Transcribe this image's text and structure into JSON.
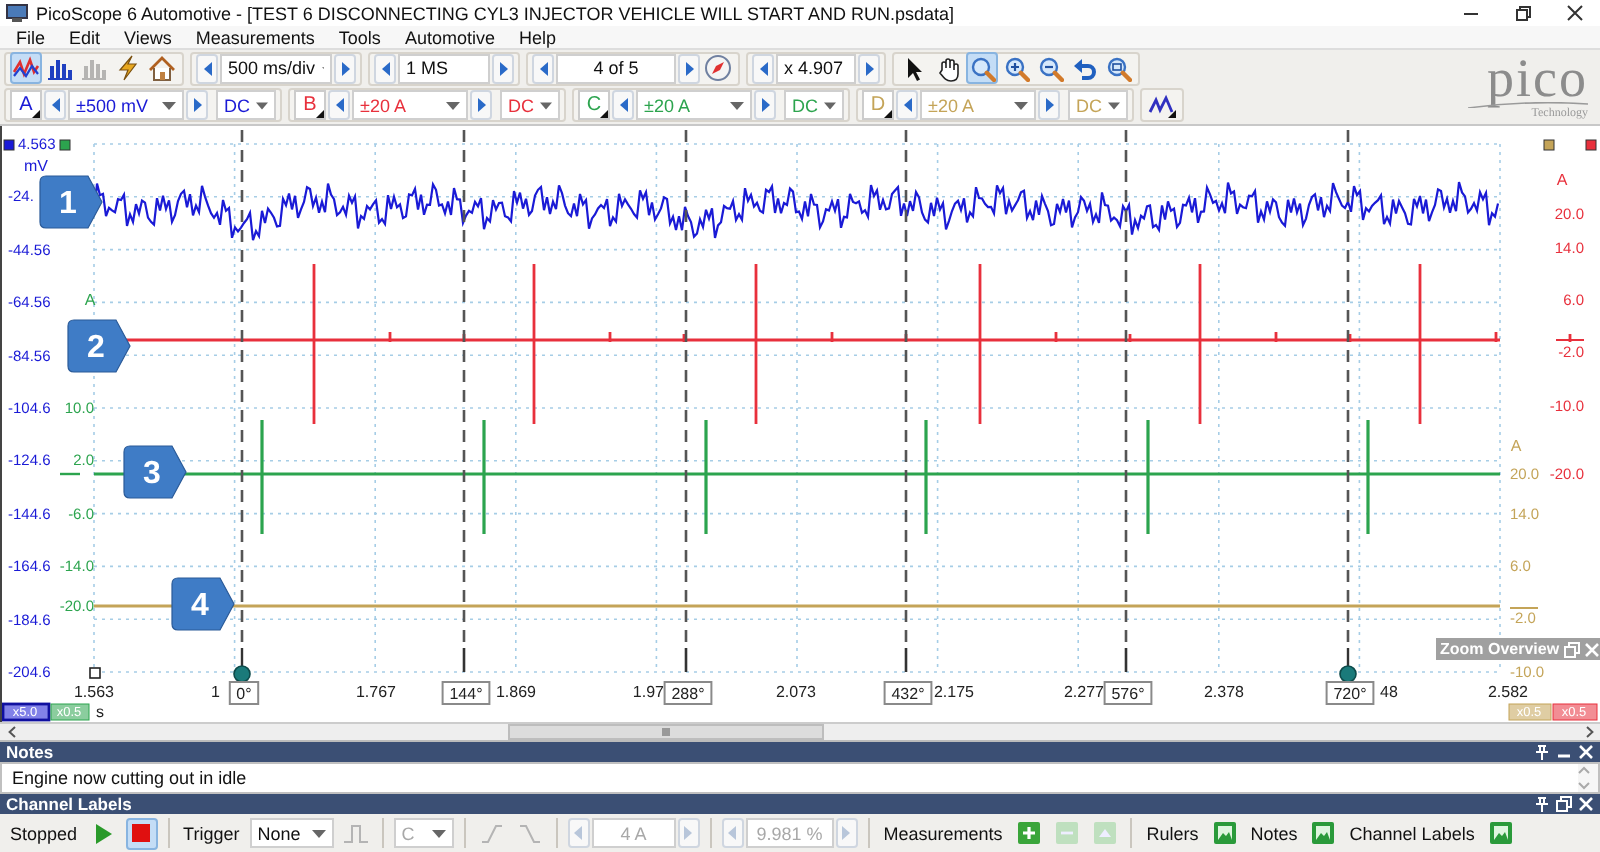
{
  "window": {
    "title": "PicoScope 6 Automotive - [TEST 6 DISCONNECTING CYL3 INJECTOR VEHICLE WILL START AND RUN.psdata]"
  },
  "menu": [
    "File",
    "Edit",
    "Views",
    "Measurements",
    "Tools",
    "Automotive",
    "Help"
  ],
  "toolbar": {
    "modes": [
      {
        "kind": "scope",
        "selected": true,
        "disabled": false
      },
      {
        "kind": "spectrum",
        "selected": false,
        "disabled": false
      },
      {
        "kind": "persistence",
        "selected": false,
        "disabled": true
      }
    ],
    "actions": [
      {
        "kind": "wizard"
      },
      {
        "kind": "home"
      }
    ],
    "timebase": "500 ms/div",
    "samples": "1 MS",
    "buffer": "4 of 5",
    "zoom_factor": "x 4.907",
    "tools": [
      {
        "kind": "pointer",
        "selected": false
      },
      {
        "kind": "hand",
        "selected": false
      },
      {
        "kind": "zoom",
        "selected": true
      },
      {
        "kind": "zoom-in",
        "selected": false
      },
      {
        "kind": "zoom-out",
        "selected": false
      },
      {
        "kind": "undo",
        "selected": false
      },
      {
        "kind": "zoom-fit",
        "selected": false
      }
    ]
  },
  "logo": {
    "wordmark": "pico",
    "tagline": "Technology"
  },
  "channels": [
    {
      "letter": "A",
      "range": "±500 mV",
      "coupling": "DC",
      "color": "#1a1ad6"
    },
    {
      "letter": "B",
      "range": "±20 A",
      "coupling": "DC",
      "color": "#e8303c"
    },
    {
      "letter": "C",
      "range": "±20 A",
      "coupling": "DC",
      "color": "#2ca44e"
    },
    {
      "letter": "D",
      "range": "±20 A",
      "coupling": "DC",
      "color": "#c4a458"
    }
  ],
  "plot": {
    "scales": [
      {
        "unit": "mV",
        "ticks": [
          "4.563",
          "-24.",
          "-44.56",
          "-64.56",
          "-84.56",
          "-104.6",
          "-124.6",
          "-144.6",
          "-164.6",
          "-184.6",
          "-204.6"
        ]
      },
      {
        "unit": "A",
        "ticks": [
          "10.0",
          "2.0",
          "-6.0",
          "-14.0",
          "-20.0"
        ]
      },
      {
        "unit": "A",
        "ticks": [
          "20.0",
          "14.0",
          "6.0",
          "-2.0",
          "-10.0",
          "-20.0"
        ]
      },
      {
        "unit": "A",
        "ticks": [
          "20.0",
          "14.0",
          "6.0",
          "-2.0",
          "-10.0"
        ]
      }
    ],
    "markers": [
      "1",
      "2",
      "3",
      "4"
    ],
    "time_ticks": [
      "1.563",
      "1",
      "1.767",
      "1.869",
      "1.97",
      "2.073",
      "2.175",
      "2.277",
      "2.378",
      "48",
      "2.582"
    ],
    "time_unit": "s",
    "rulers": [
      {
        "label": "0°",
        "kind": "handle"
      },
      {
        "label": "144°",
        "kind": "stub"
      },
      {
        "label": "288°",
        "kind": "stub"
      },
      {
        "label": "432°",
        "kind": "stub"
      },
      {
        "label": "576°",
        "kind": "stub"
      },
      {
        "label": "720°",
        "kind": "handle"
      }
    ],
    "scale_badges": [
      {
        "label": "x5.0",
        "selected": true
      },
      {
        "label": "x0.5",
        "selected": false
      },
      {
        "label": "x0.5",
        "selected": false
      },
      {
        "label": "x0.5",
        "selected": false
      }
    ],
    "zoom_overview": {
      "title": "Zoom Overview"
    }
  },
  "notes": {
    "title": "Notes",
    "text": "Engine now cutting out in idle"
  },
  "channel_labels": {
    "title": "Channel Labels"
  },
  "status_bar": {
    "status": "Stopped",
    "running": false,
    "trigger_label": "Trigger",
    "trigger_mode": "None",
    "trigger_source": "C",
    "threshold": "4 A",
    "pre_trigger": "9.981 %",
    "trigger_controls_disabled": true,
    "measurements_label": "Measurements",
    "toggles": [
      "Rulers",
      "Notes",
      "Channel Labels"
    ]
  }
}
